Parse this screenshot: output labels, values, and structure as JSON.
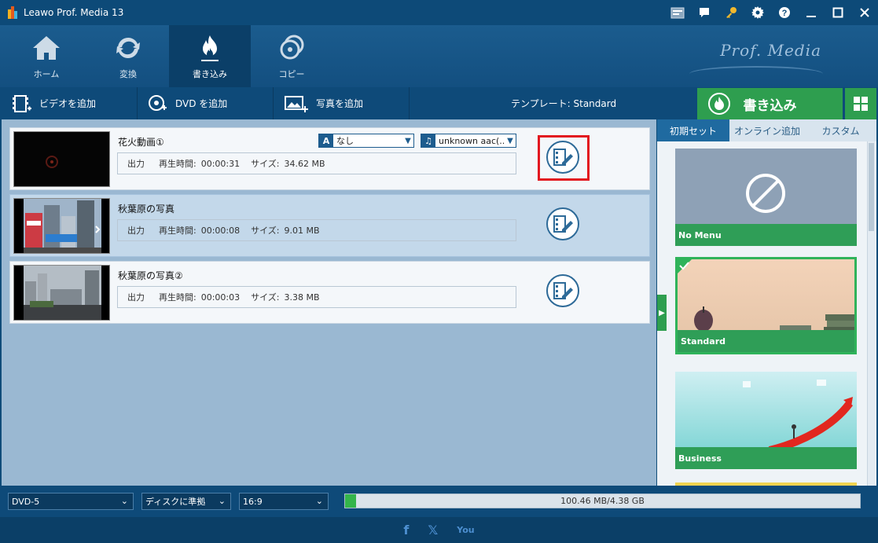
{
  "window": {
    "title": "Leawo Prof. Media 13",
    "titlebar_icons": [
      "screenshot-icon",
      "chat-icon",
      "key-icon",
      "gear-icon",
      "help-icon",
      "minimize-icon",
      "maximize-icon",
      "close-icon"
    ]
  },
  "nav": {
    "items": [
      {
        "label": "ホーム",
        "icon": "home-icon"
      },
      {
        "label": "変換",
        "icon": "convert-icon"
      },
      {
        "label": "書き込み",
        "icon": "fire-icon",
        "active": true
      },
      {
        "label": "コピー",
        "icon": "disc-copy-icon"
      }
    ],
    "brand": "Prof. Media"
  },
  "toolbar": {
    "add_video": "ビデオを追加",
    "add_dvd": "DVD を追加",
    "add_photo": "写真を追加",
    "template": "テンプレート: Standard",
    "burn": "書き込み"
  },
  "items": [
    {
      "title": "花火動画①",
      "output_label": "出力",
      "duration_label": "再生時間:",
      "duration": "00:00:31",
      "size_label": "サイズ:",
      "size": "34.62 MB",
      "subtitle": "なし",
      "audio": "unknown aac(..",
      "highlighted": true
    },
    {
      "title": "秋葉原の写真",
      "output_label": "出力",
      "duration_label": "再生時間:",
      "duration": "00:00:08",
      "size_label": "サイズ:",
      "size": "9.01 MB"
    },
    {
      "title": "秋葉原の写真②",
      "output_label": "出力",
      "duration_label": "再生時間:",
      "duration": "00:00:03",
      "size_label": "サイズ:",
      "size": "3.38 MB"
    }
  ],
  "right_panel": {
    "tabs": [
      "初期セット",
      "オンライン追加",
      "カスタム"
    ],
    "active_tab": 0,
    "templates": [
      "No Menu",
      "Standard",
      "Business"
    ],
    "selected_template": "Standard"
  },
  "status": {
    "disc_type": "DVD-5",
    "quality": "ディスクに準拠",
    "aspect": "16:9",
    "capacity": "100.46 MB/4.38 GB",
    "capacity_fraction": 0.022
  },
  "footer": {
    "social": [
      "f",
      "𝕏",
      "You"
    ]
  },
  "colors": {
    "accent_green": "#2e9e4f",
    "nav_blue": "#134f80",
    "highlight_red": "#e2171f"
  }
}
